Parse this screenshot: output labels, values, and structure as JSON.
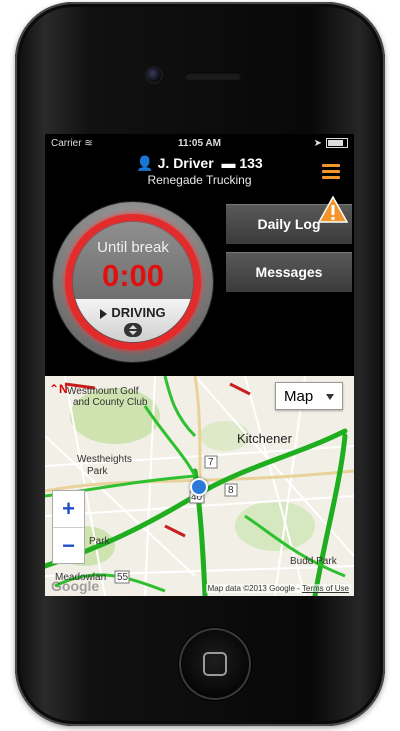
{
  "status_bar": {
    "carrier": "Carrier",
    "time": "11:05 AM"
  },
  "header": {
    "driver": "J. Driver",
    "truck": "133",
    "company": "Renegade Trucking"
  },
  "timer": {
    "label": "Until break",
    "value": "0:00",
    "status": "DRIVING"
  },
  "buttons": {
    "daily_log": "Daily Log",
    "messages": "Messages"
  },
  "map": {
    "type_select": "Map",
    "zoom_in": "+",
    "zoom_out": "−",
    "labels": {
      "golf": "Westmount Golf",
      "golf2": "and County Club",
      "city": "Kitchener",
      "park1": "Westheights",
      "park1b": "Park",
      "park2": "Park",
      "budd": "Budd Park",
      "meadow": "Meadowlan",
      "hwy7": "7",
      "hwy8": "8",
      "hwy40": "40",
      "hwy55": "55"
    },
    "attribution": "Map data ©2013 Google -",
    "terms": "Terms of Use",
    "logo": "Google"
  },
  "colors": {
    "accent": "#f2962c",
    "timer_red": "#e01010",
    "ring_red": "#e32b2b",
    "traffic_green": "#1fae1f"
  }
}
